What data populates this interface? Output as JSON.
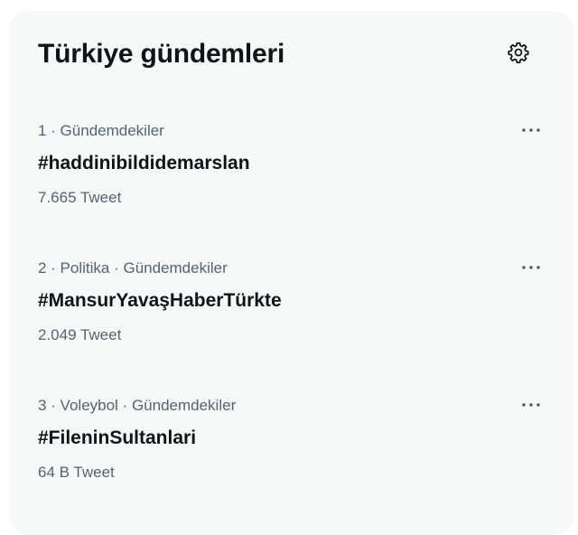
{
  "header": {
    "title": "Türkiye gündemleri",
    "settings_icon": "gear-icon"
  },
  "trends": [
    {
      "meta": "1 · Gündemdekiler",
      "name": "#haddinibildidemarslan",
      "count": "7.665 Tweet",
      "more_icon": "more-horizontal-icon"
    },
    {
      "meta": "2 · Politika · Gündemdekiler",
      "name": "#MansurYavaşHaberTürkte",
      "count": "2.049 Tweet",
      "more_icon": "more-horizontal-icon"
    },
    {
      "meta": "3 · Voleybol · Gündemdekiler",
      "name": "#FileninSultanlari",
      "count": "64 B Tweet",
      "more_icon": "more-horizontal-icon"
    }
  ],
  "colors": {
    "panel_background": "#f7f9f9",
    "primary_text": "#0f1419",
    "secondary_text": "#536471"
  }
}
